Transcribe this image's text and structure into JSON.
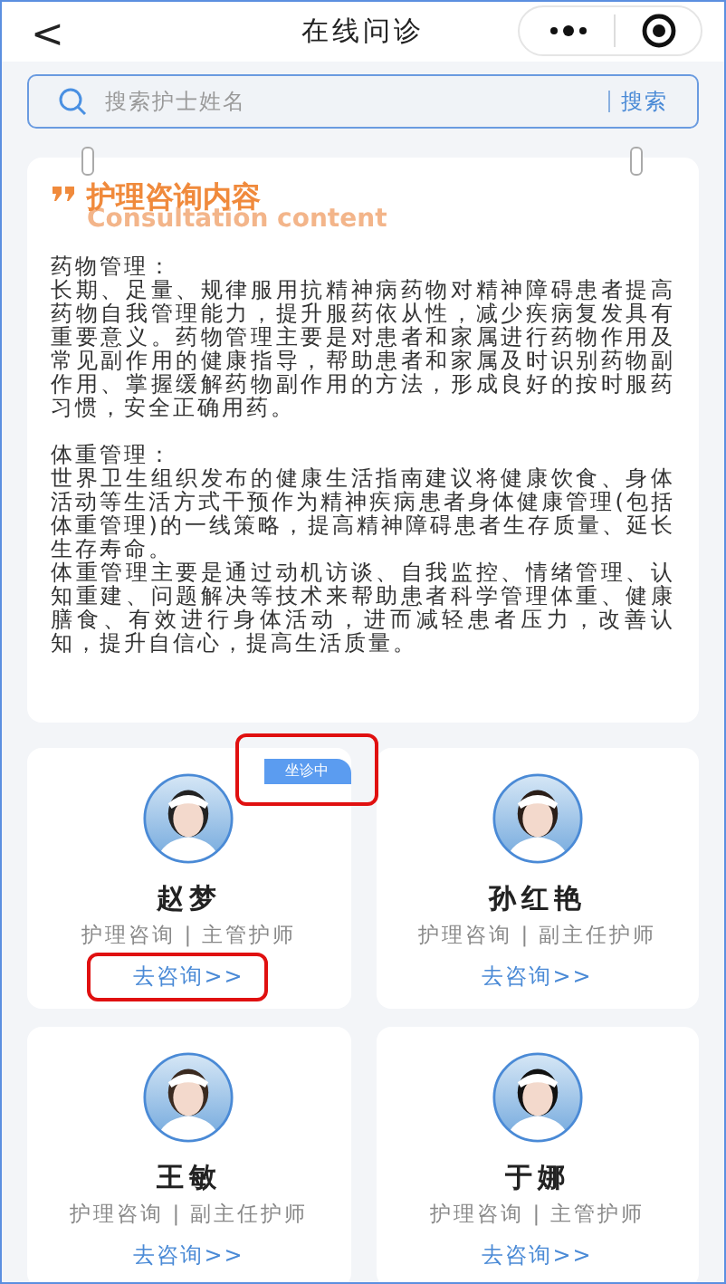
{
  "header": {
    "back": "<",
    "title": "在线问诊"
  },
  "search": {
    "placeholder": "搜索护士姓名",
    "button": "搜索"
  },
  "content": {
    "title": "护理咨询内容",
    "subtitle": "Consultation content",
    "sections": [
      {
        "heading": "药物管理：",
        "paragraphs": [
          "长期、足量、规律服用抗精神病药物对精神障碍患者提高药物自我管理能力，提升服药依从性，减少疾病复发具有重要意义。药物管理主要是对患者和家属进行药物作用及常见副作用的健康指导，帮助患者和家属及时识别药物副作用、掌握缓解药物副作用的方法，形成良好的按时服药习惯，安全正确用药。"
        ]
      },
      {
        "heading": "体重管理：",
        "paragraphs": [
          "世界卫生组织发布的健康生活指南建议将健康饮食、身体活动等生活方式干预作为精神疾病患者身体健康管理(包括体重管理)的一线策略，提高精神障碍患者生存质量、延长生存寿命。",
          "体重管理主要是通过动机访谈、自我监控、情绪管理、认知重建、问题解决等技术来帮助患者科学管理体重、健康膳食、有效进行身体活动，进而减轻患者压力，改善认知，提升自信心，提高生活质量。"
        ]
      }
    ]
  },
  "nurses": [
    {
      "name": "赵梦",
      "title": "护理咨询 | 主管护师",
      "link": "去咨询>>",
      "badge": "坐诊中",
      "badge_highlighted": true,
      "link_highlighted": true
    },
    {
      "name": "孙红艳",
      "title": "护理咨询 | 副主任护师",
      "link": "去咨询>>",
      "badge_highlighted": false,
      "link_highlighted": false
    },
    {
      "name": "王敏",
      "title": "护理咨询 | 副主任护师",
      "link": "去咨询>>",
      "badge_highlighted": false,
      "link_highlighted": false
    },
    {
      "name": "于娜",
      "title": "护理咨询 | 主管护师",
      "link": "去咨询>>",
      "badge_highlighted": false,
      "link_highlighted": false
    }
  ]
}
